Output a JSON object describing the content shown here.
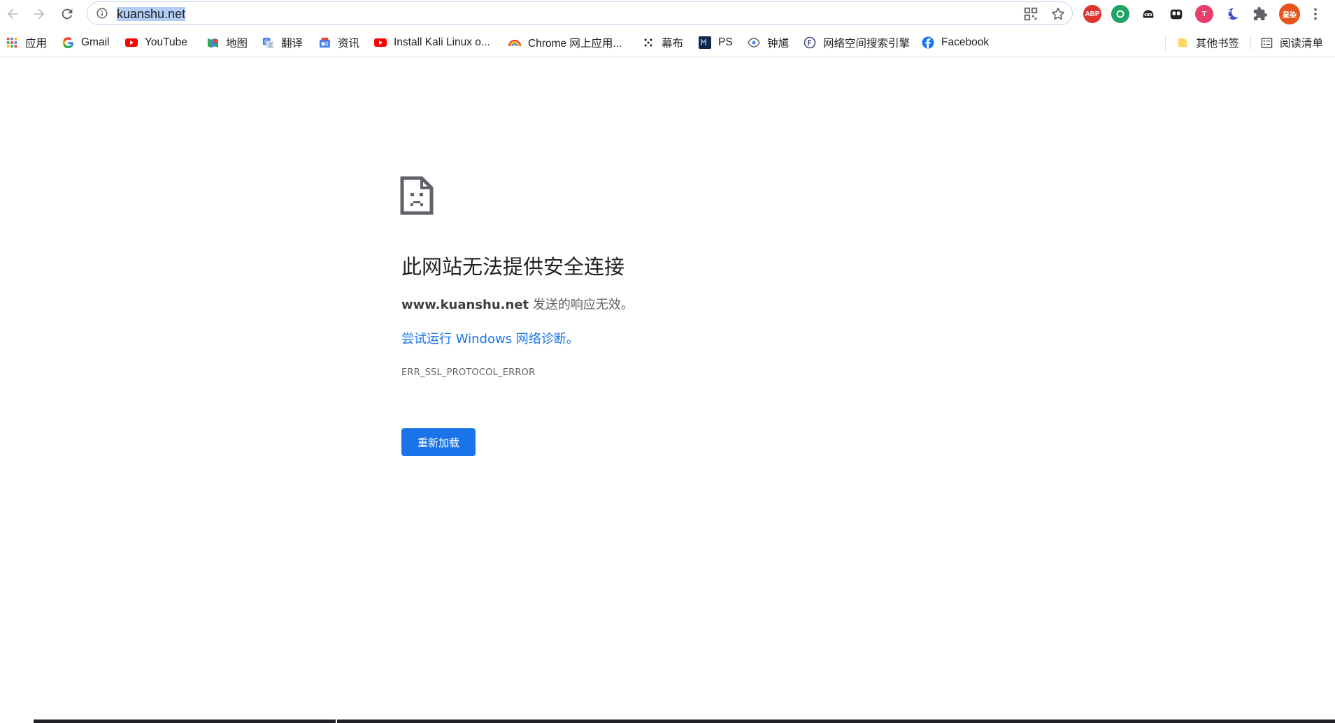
{
  "toolbar": {
    "url": "kuanshu.net",
    "profile_label": "星染",
    "extensions": [
      {
        "name": "abp",
        "label": "ABP",
        "color": "#e0342f"
      },
      {
        "name": "green-ext",
        "color": "#1fa463"
      },
      {
        "name": "ninja-ext",
        "color": "#202124"
      },
      {
        "name": "kami-ext",
        "color": "#202124"
      },
      {
        "name": "t-ext",
        "label": "T",
        "color": "#e83e6c"
      },
      {
        "name": "moon-ext",
        "color": "#3b4bc9"
      }
    ],
    "profile_color": "#e8541c"
  },
  "bookmarks": {
    "items": [
      {
        "label": "应用",
        "icon": "apps-grid-icon"
      },
      {
        "label": "Gmail",
        "icon": "google-g-icon"
      },
      {
        "label": "YouTube",
        "icon": "youtube-icon"
      },
      {
        "label": "地图",
        "icon": "maps-icon"
      },
      {
        "label": "翻译",
        "icon": "translate-icon"
      },
      {
        "label": "资讯",
        "icon": "news-icon"
      },
      {
        "label": "Install Kali Linux o...",
        "icon": "youtube-icon"
      },
      {
        "label": "Chrome 网上应用...",
        "icon": "rainbow-icon"
      },
      {
        "label": "幕布",
        "icon": "mubu-icon"
      },
      {
        "label": "PS",
        "icon": "ps-icon"
      },
      {
        "label": "钟馗",
        "icon": "eye-icon"
      },
      {
        "label": "网络空间搜索引擎",
        "icon": "fofa-icon"
      },
      {
        "label": "Facebook",
        "icon": "facebook-icon"
      }
    ],
    "other_bookmarks": "其他书签",
    "reading_list": "阅读清单"
  },
  "error": {
    "title": "此网站无法提供安全连接",
    "domain": "www.kuanshu.net",
    "desc_suffix": " 发送的响应无效。",
    "link": "尝试运行 Windows 网络诊断。",
    "code": "ERR_SSL_PROTOCOL_ERROR",
    "reload_label": "重新加载"
  },
  "colors": {
    "accent": "#1a73e8",
    "url_highlight": "#b3cdf5"
  }
}
